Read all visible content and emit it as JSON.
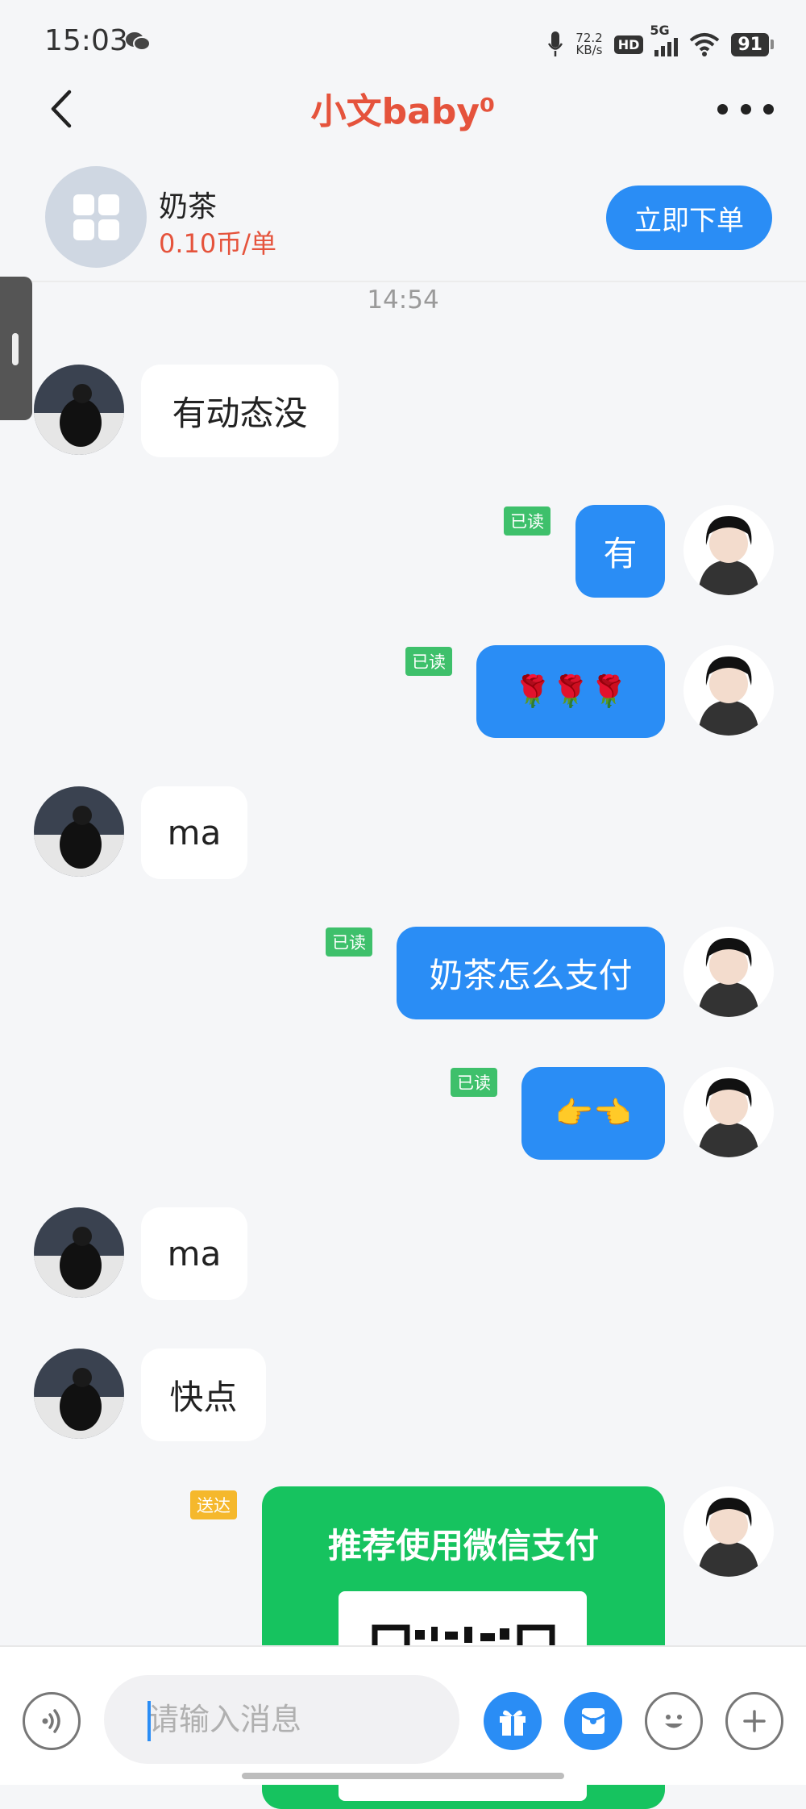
{
  "status_bar": {
    "time": "15:03",
    "speed_value": "72.2",
    "speed_unit": "KB/s",
    "hd": "HD",
    "network": "5G",
    "battery": "91"
  },
  "header": {
    "title": "小文baby⁰"
  },
  "product": {
    "name": "奶茶",
    "price": "0.10币/单",
    "order_button": "立即下单"
  },
  "chat": {
    "timestamp": "14:54",
    "read_label": "已读",
    "delivered_label": "送达",
    "messages": [
      {
        "from": "them",
        "text": "有动态没"
      },
      {
        "from": "me",
        "text": "有",
        "status": "已读"
      },
      {
        "from": "me",
        "text": "🌹🌹🌹",
        "status": "已读"
      },
      {
        "from": "them",
        "text": "ma"
      },
      {
        "from": "me",
        "text": "奶茶怎么支付",
        "status": "已读"
      },
      {
        "from": "me",
        "text": "👉👈",
        "status": "已读"
      },
      {
        "from": "them",
        "text": "ma"
      },
      {
        "from": "them",
        "text": "快点"
      },
      {
        "from": "me",
        "card_title": "推荐使用微信支付",
        "status": "送达"
      }
    ]
  },
  "input_bar": {
    "placeholder": "请输入消息"
  },
  "icons": {
    "voice": "voice-icon",
    "gift": "gift-icon",
    "red_packet": "red-packet-icon",
    "emoji": "emoji-icon",
    "plus": "plus-icon"
  },
  "colors": {
    "accent": "#2a8df5",
    "title": "#e5533c",
    "read": "#3ec06b",
    "delivered": "#f5b82c",
    "wechat_pay": "#16c35f"
  }
}
